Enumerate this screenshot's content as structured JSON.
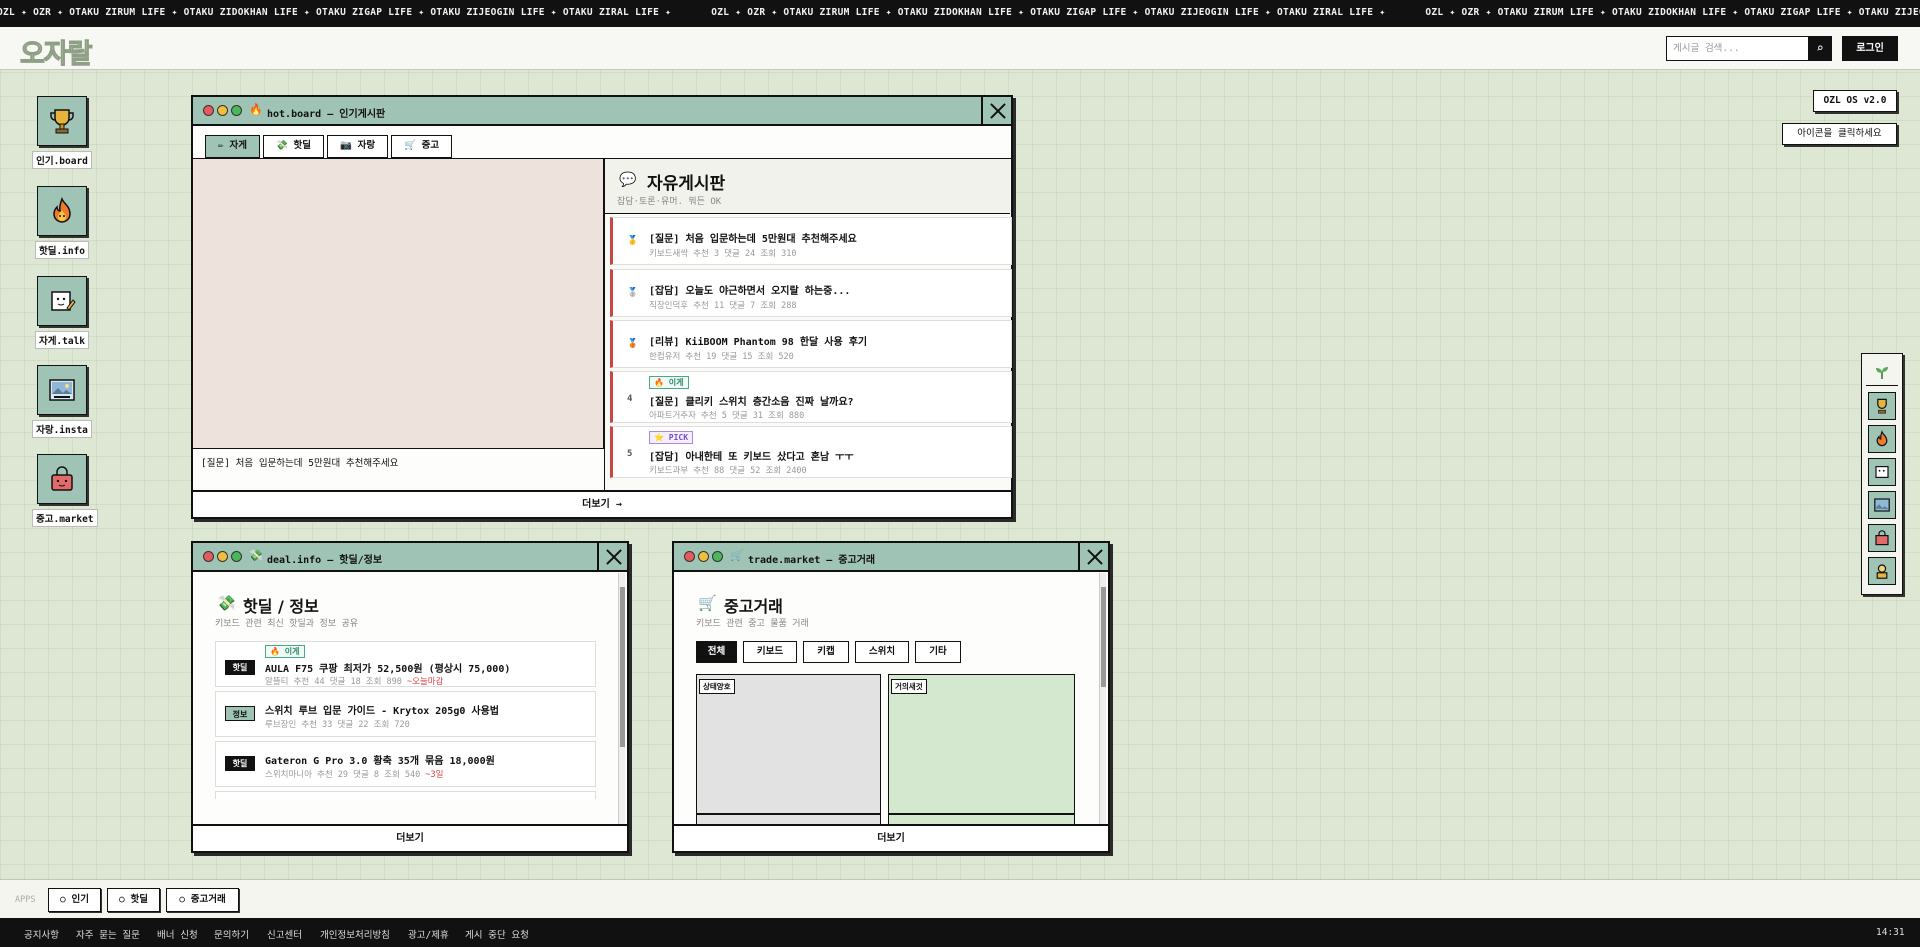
{
  "marquee": {
    "text": "OZL ✦ OZR ✦ OTAKU ZIRUM LIFE ✦ OTAKU ZIDOKHAN LIFE ✦ OTAKU ZIGAP LIFE ✦ OTAKU ZIJEOGIN LIFE ✦ OTAKU ZIRAL LIFE ✦"
  },
  "header": {
    "logo": "오자랄",
    "search_placeholder": "게시글 검색...",
    "search_icon": "⌕",
    "login_label": "로그인"
  },
  "desktop_icons": [
    {
      "label": "인기.board",
      "icon": "trophy-icon"
    },
    {
      "label": "핫딜.info",
      "icon": "fire-icon"
    },
    {
      "label": "자게.talk",
      "icon": "memo-icon"
    },
    {
      "label": "자랑.insta",
      "icon": "photo-icon"
    },
    {
      "label": "중고.market",
      "icon": "bag-icon"
    }
  ],
  "os": {
    "version_label": "OZL OS v2.0",
    "hint": "아이콘을 클릭하세요"
  },
  "hot_window": {
    "title": "hot.board — 인기게시판",
    "tabs": [
      {
        "label": "자게",
        "icon": "✏"
      },
      {
        "label": "핫딜",
        "icon": "💸"
      },
      {
        "label": "자랑",
        "icon": "📷"
      },
      {
        "label": "중고",
        "icon": "🛒"
      }
    ],
    "preview_caption": "[질문] 처음 입문하는데 5만원대 추천해주세요",
    "board_icon": "💬",
    "board_title": "자유게시판",
    "board_subtitle": "잡담·토론·유머. 뭐든 OK",
    "posts": [
      {
        "rank": "🥇",
        "title": "[질문] 처음 입문하는데 5만원대 추천해주세요",
        "meta": "키보드새싹 추천 3 댓글 24 조회 310"
      },
      {
        "rank": "🥈",
        "title": "[잡담] 오늘도 야근하면서 오지랄 하는중...",
        "meta": "직장인덕후 추천 11 댓글 7 조회 288"
      },
      {
        "rank": "🥉",
        "title": "[리뷰] KiiBOOM Phantom 98 한달 사용 후기",
        "meta": "한컴유저 추천 19 댓글 15 조회 520"
      },
      {
        "rank": "4",
        "badge": "🔥 이게",
        "title": "[질문] 클리키 스위치 층간소음 진짜 날까요?",
        "meta": "아파트거주자 추천 5 댓글 31 조회 880"
      },
      {
        "rank": "5",
        "badge": "⭐ PICK",
        "title": "[잡담] 아내한테 또 키보드 샀다고 혼남 ㅜㅜ",
        "meta": "키보드과부 추천 88 댓글 52 조회 2400"
      }
    ],
    "more_label": "더보기 →"
  },
  "deal_window": {
    "title": "deal.info — 핫딜/정보",
    "heading_icon": "💸",
    "heading": "핫딜 / 정보",
    "subtitle": "키보드 관련 최신 핫딜과 정보 공유",
    "items": [
      {
        "tag": "핫딜",
        "badge": "🔥 이게",
        "title": "AULA F75 쿠팡 최저가 52,500원 (평상시 75,000)",
        "meta": "알뜰티 추천 44 댓글 18 조회 890",
        "note": "~오늘마감"
      },
      {
        "tag": "정보",
        "title": "스위치 루브 입문 가이드 - Krytox 205g0 사용법",
        "meta": "루브장인 추천 33 댓글 22 조회 720"
      },
      {
        "tag": "핫딜",
        "title": "Gateron G Pro 3.0 황축 35개 묶음 18,000원",
        "meta": "스위치마니아 추천 29 댓글 8 조회 540",
        "note": "~3일"
      }
    ],
    "more_label": "더보기"
  },
  "trade_window": {
    "title": "trade.market — 중고거래",
    "heading_icon": "🛒",
    "heading": "중고거래",
    "subtitle": "키보드 관련 중고 물품 거래",
    "filters": [
      "전체",
      "키보드",
      "키캡",
      "스위치",
      "기타"
    ],
    "cards": [
      {
        "status": "상태양호"
      },
      {
        "status": "거의새것"
      }
    ],
    "more_label": "더보기"
  },
  "right_dock": {
    "items": [
      "sprout-icon",
      "trophy-icon",
      "fire-icon",
      "memo-icon",
      "photo-icon",
      "bag-icon",
      "person-icon"
    ]
  },
  "apps_bar": {
    "label": "APPS",
    "apps": [
      "○ 인기",
      "○ 핫딜",
      "○ 중고거래"
    ]
  },
  "footer": {
    "links": [
      "공지사항",
      "자주 묻는 질문",
      "배너 신청",
      "문의하기",
      "신고센터",
      "개인정보처리방침",
      "광고/제휴",
      "게시 중단 요청"
    ],
    "clock": "14:31"
  },
  "colors": {
    "window_title": "#9fc4b5",
    "desktop_bg": "#dde7d3",
    "accent_red": "#c94646"
  }
}
